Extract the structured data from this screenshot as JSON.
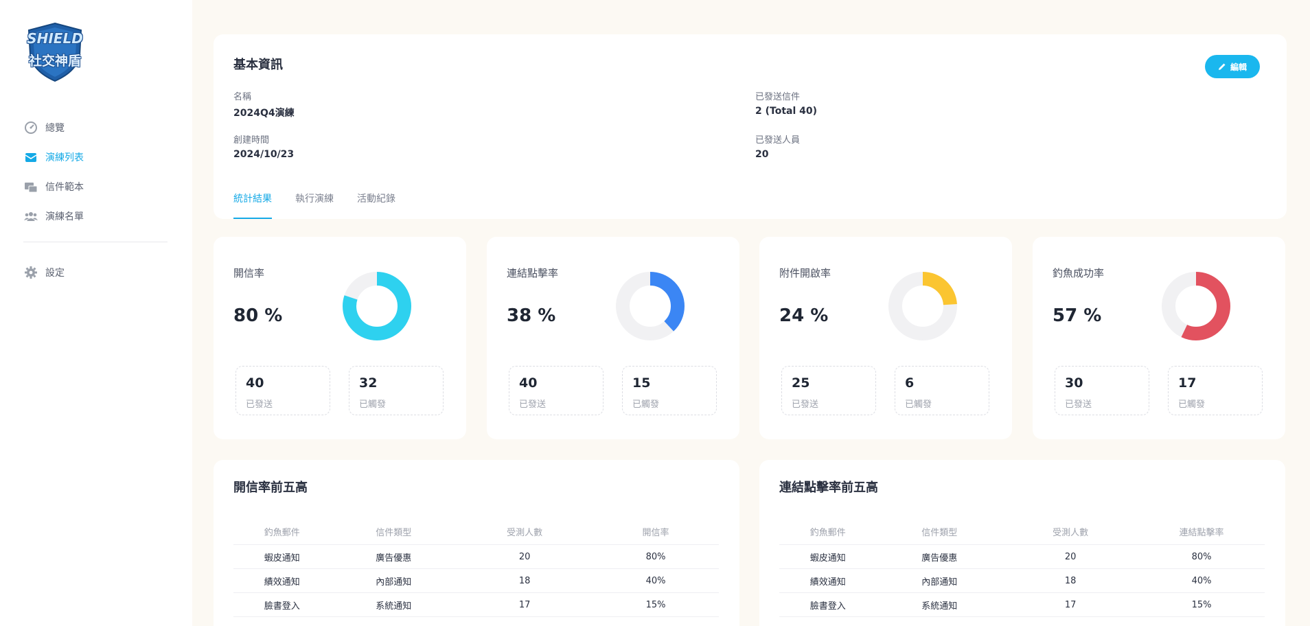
{
  "app": {
    "logo_top": "SHIELD",
    "logo_bottom": "社交神盾"
  },
  "sidebar": {
    "items": [
      {
        "label": "總覽",
        "icon": "dashboard-icon"
      },
      {
        "label": "演練列表",
        "icon": "mail-list-icon",
        "active": true
      },
      {
        "label": "信件範本",
        "icon": "mail-template-icon"
      },
      {
        "label": "演練名單",
        "icon": "users-icon"
      }
    ],
    "settings": {
      "label": "設定",
      "icon": "gear-icon"
    }
  },
  "info": {
    "title": "基本資訊",
    "edit_label": "編輯",
    "name_label": "名稱",
    "name_value": "2024Q4演練",
    "created_label": "創建時間",
    "created_value": "2024/10/23",
    "sent_mail_label": "已發送信件",
    "sent_mail_value": "2 (Total 40)",
    "sent_people_label": "已發送人員",
    "sent_people_value": "20"
  },
  "tabs": [
    {
      "label": "統計結果",
      "active": true
    },
    {
      "label": "執行演練"
    },
    {
      "label": "活動紀錄"
    }
  ],
  "stats": [
    {
      "label": "開信率",
      "value": "80 %",
      "ratio": 0.8,
      "color": "#2ed1ef",
      "box1_num": "40",
      "box1_cap": "已發送",
      "box2_num": "32",
      "box2_cap": "已觸發"
    },
    {
      "label": "連結點擊率",
      "value": "38 %",
      "ratio": 0.38,
      "color": "#3b86f4",
      "box1_num": "40",
      "box1_cap": "已發送",
      "box2_num": "15",
      "box2_cap": "已觸發"
    },
    {
      "label": "附件開啟率",
      "value": "24 %",
      "ratio": 0.24,
      "color": "#fbc531",
      "box1_num": "25",
      "box1_cap": "已發送",
      "box2_num": "6",
      "box2_cap": "已觸發"
    },
    {
      "label": "釣魚成功率",
      "value": "57 %",
      "ratio": 0.57,
      "color": "#e2525f",
      "box1_num": "30",
      "box1_cap": "已發送",
      "box2_num": "17",
      "box2_cap": "已觸發"
    }
  ],
  "tables": [
    {
      "title": "開信率前五高",
      "headers": [
        "釣魚郵件",
        "信件類型",
        "受測人數",
        "開信率"
      ],
      "rows": [
        [
          "蝦皮通知",
          "廣告優惠",
          "20",
          "80%"
        ],
        [
          "績效通知",
          "內部通知",
          "18",
          "40%"
        ],
        [
          "臉書登入",
          "系統通知",
          "17",
          "15%"
        ]
      ]
    },
    {
      "title": "連結點擊率前五高",
      "headers": [
        "釣魚郵件",
        "信件類型",
        "受測人數",
        "連結點擊率"
      ],
      "rows": [
        [
          "蝦皮通知",
          "廣告優惠",
          "20",
          "80%"
        ],
        [
          "績效通知",
          "內部通知",
          "18",
          "40%"
        ],
        [
          "臉書登入",
          "系統通知",
          "17",
          "15%"
        ]
      ]
    }
  ]
}
